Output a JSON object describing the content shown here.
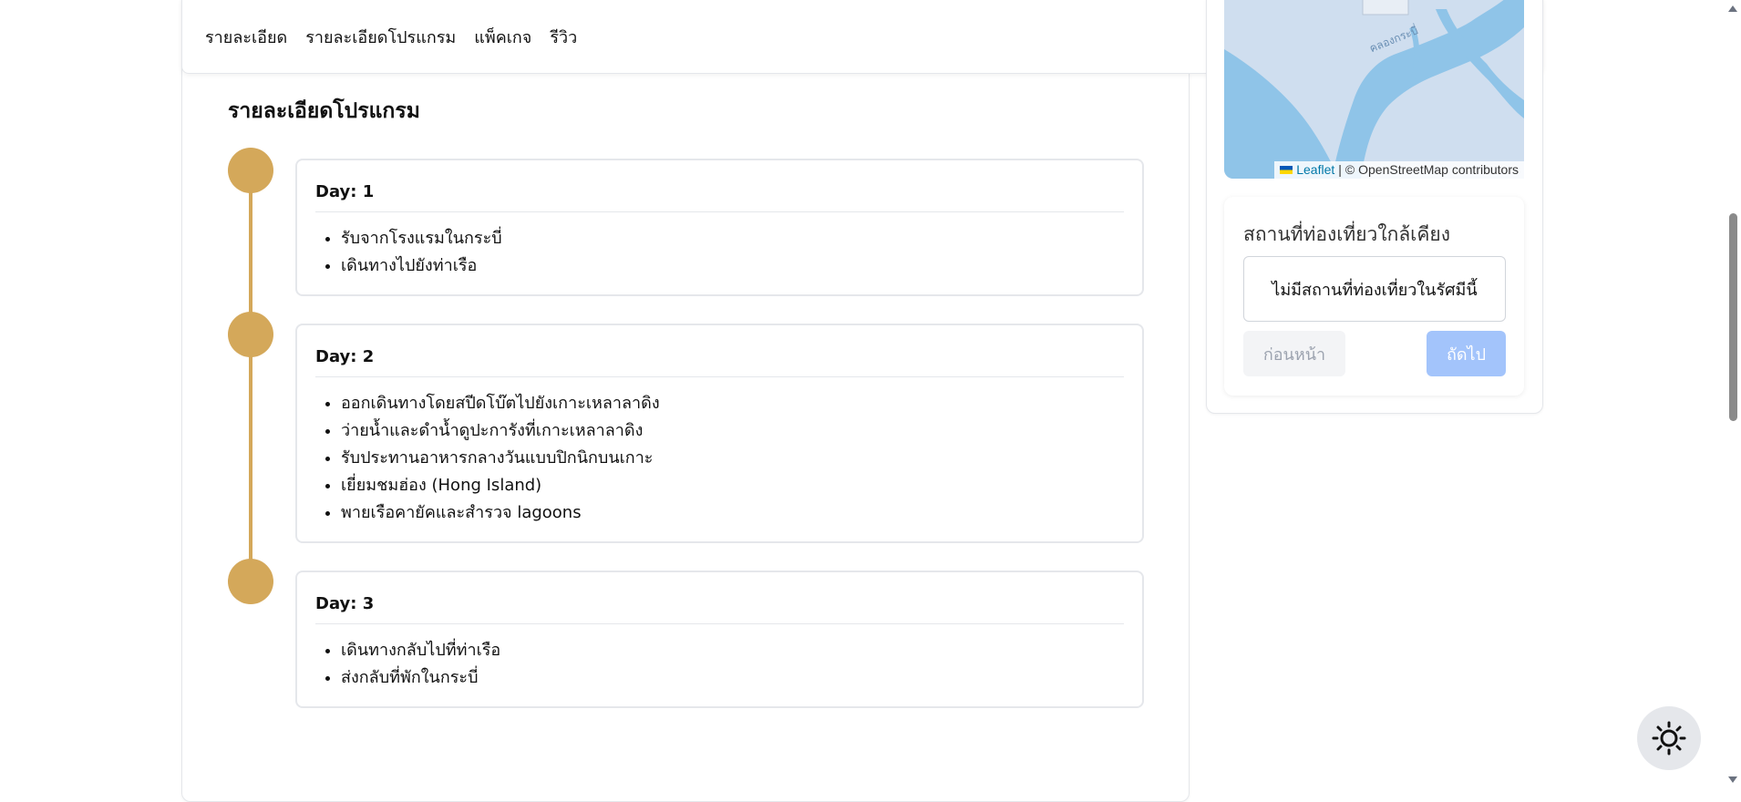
{
  "tabs": [
    {
      "label": "รายละเอียด"
    },
    {
      "label": "รายละเอียดโปรแกรม"
    },
    {
      "label": "แพ็คเกจ"
    },
    {
      "label": "รีวิว"
    }
  ],
  "program": {
    "title": "รายละเอียดโปรแกรม",
    "days": [
      {
        "title": "Day: 1",
        "items": [
          "รับจากโรงแรมในกระบี่",
          "เดินทางไปยังท่าเรือ"
        ]
      },
      {
        "title": "Day: 2",
        "items": [
          "ออกเดินทางโดยสปีดโบ๊ตไปยังเกาะเหลาลาดิง",
          "ว่ายน้ำและดำน้ำดูปะการังที่เกาะเหลาลาดิง",
          "รับประทานอาหารกลางวันแบบปิกนิกบนเกาะ",
          "เยี่ยมชมฮ่อง (Hong Island)",
          "พายเรือคายัคและสำรวจ lagoons"
        ]
      },
      {
        "title": "Day: 3",
        "items": [
          "เดินทางกลับไปที่ท่าเรือ",
          "ส่งกลับที่พักในกระบี่"
        ]
      }
    ]
  },
  "map": {
    "label": "คลองกระบี่",
    "attribution": {
      "leaflet": "Leaflet",
      "separator": "|",
      "osm": "© OpenStreetMap contributors"
    },
    "colors": {
      "land": "#cfdeef",
      "water": "#8fc4e8"
    }
  },
  "nearby": {
    "title": "สถานที่ท่องเที่ยวใกล้เคียง",
    "empty_message": "ไม่มีสถานที่ท่องเที่ยวในรัศมีนี้",
    "prev_label": "ก่อนหน้า",
    "next_label": "ถัดไป"
  },
  "theme_toggle": {
    "icon": "sun-icon"
  },
  "colors": {
    "timeline": "#d4a85a",
    "next_button": "#a3c4fb",
    "prev_button": "#f3f4f6"
  }
}
